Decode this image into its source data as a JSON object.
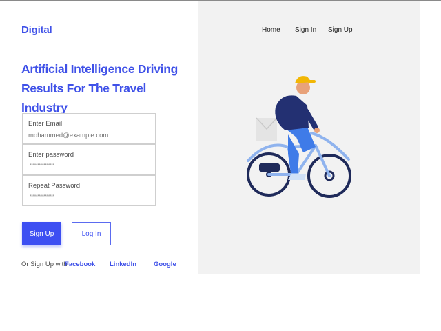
{
  "brand": "Digital",
  "headline": "Artificial Intelligence Driving Results For The Travel Industry",
  "form": {
    "email_label": "Enter Email",
    "email_placeholder": "mohammed@example.com",
    "password_label": "Enter password",
    "password_value": "****************",
    "repeat_label": "Repeat Password",
    "repeat_value": "****************"
  },
  "buttons": {
    "signup": "Sign Up",
    "login": "Log In"
  },
  "social": {
    "prompt": "Or Sign Up with",
    "links": [
      "Facebook",
      "LinkedIn",
      "Google"
    ]
  },
  "nav": {
    "items": [
      "Home",
      "Sign In",
      "Sign Up"
    ]
  },
  "colors": {
    "accent": "#3d4ff2",
    "panel": "#f2f2f2"
  },
  "illustration": "cyclist-illustration"
}
